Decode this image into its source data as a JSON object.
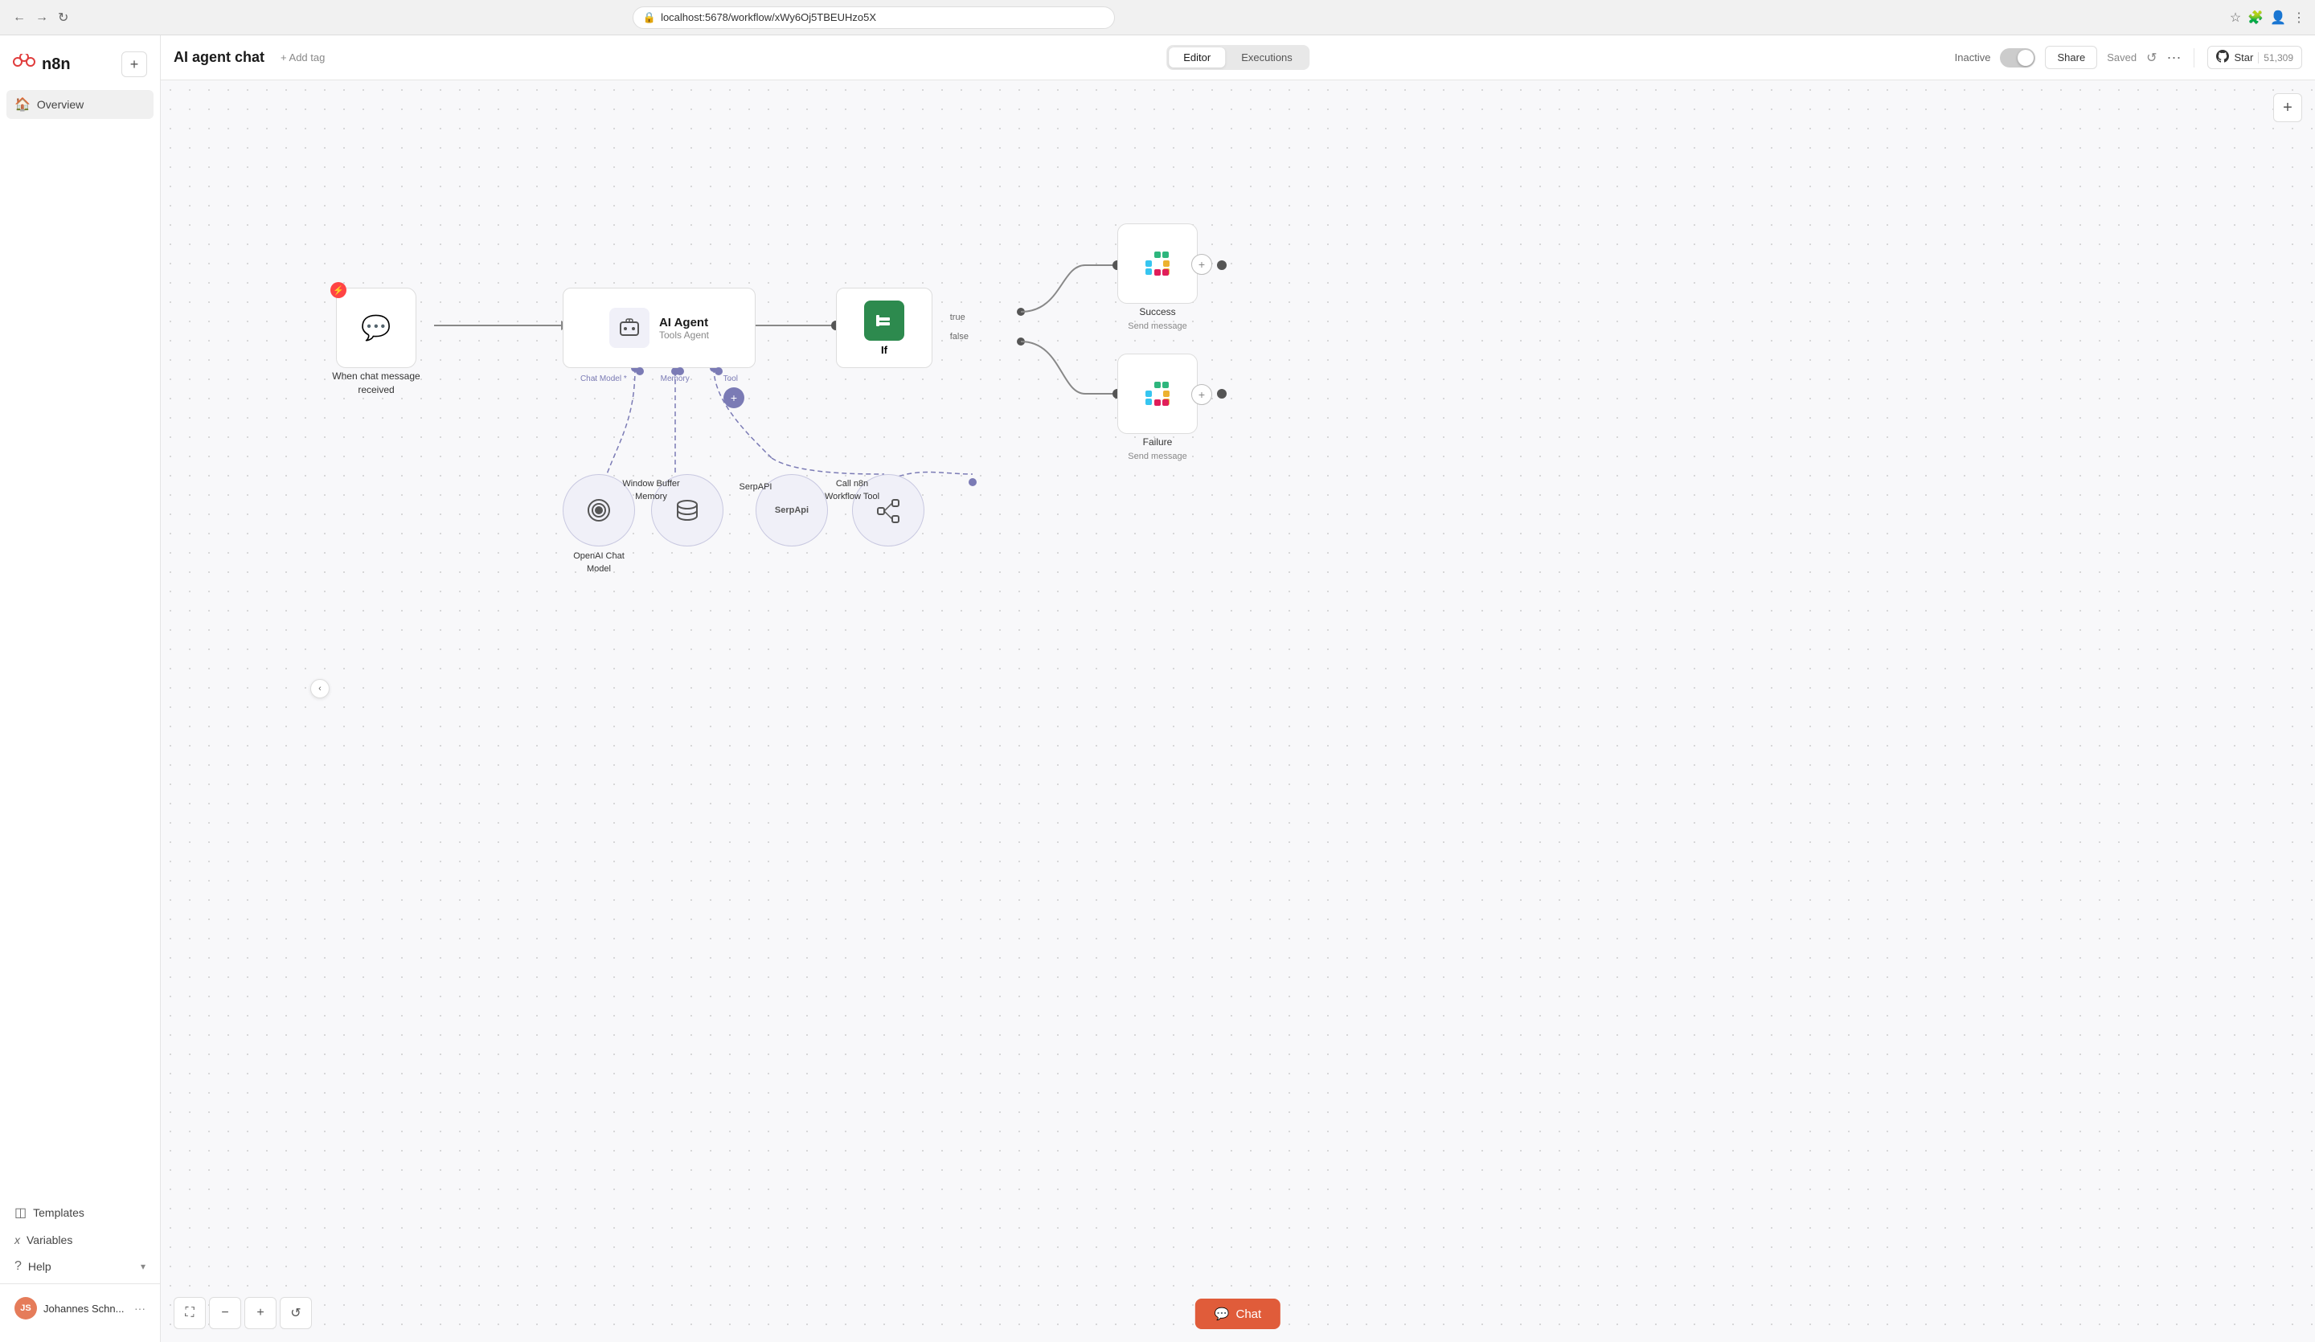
{
  "browser": {
    "url": "localhost:5678/workflow/xWy6Oj5TBEUHzo5X",
    "back": "←",
    "forward": "→",
    "refresh": "↻",
    "lock_icon": "🔒",
    "star_icon": "☆",
    "extensions_icon": "🧩",
    "profile_icon": "👤",
    "menu_icon": "⋮"
  },
  "sidebar": {
    "logo_text": "n8n",
    "add_button": "+",
    "nav_items": [
      {
        "id": "overview",
        "label": "Overview",
        "icon": "🏠"
      },
      {
        "id": "templates",
        "label": "Templates",
        "icon": "◫"
      },
      {
        "id": "variables",
        "label": "Variables",
        "icon": "✕"
      },
      {
        "id": "help",
        "label": "Help",
        "icon": "?"
      }
    ],
    "user": {
      "initials": "JS",
      "name": "Johannes Schn...",
      "more_icon": "···"
    },
    "collapse_icon": "‹"
  },
  "workflow_header": {
    "title": "AI agent chat",
    "add_tag": "+ Add tag",
    "inactive_label": "Inactive",
    "share_label": "Share",
    "saved_label": "Saved",
    "history_icon": "↺",
    "more_icon": "···",
    "star_label": "Star",
    "star_count": "51,309",
    "github_icon": "⬡"
  },
  "tabs": [
    {
      "id": "editor",
      "label": "Editor",
      "active": true
    },
    {
      "id": "executions",
      "label": "Executions",
      "active": false
    }
  ],
  "canvas": {
    "zoom_add": "+",
    "nodes": {
      "trigger": {
        "label": "When chat message",
        "label2": "received",
        "icon": "💬",
        "lightning": "⚡"
      },
      "ai_agent": {
        "label": "AI Agent",
        "sublabel": "Tools Agent",
        "connector_labels": [
          "Chat Model *",
          "Memory",
          "Tool"
        ]
      },
      "if_node": {
        "label": "If"
      },
      "success": {
        "label": "Success",
        "sublabel": "Send message"
      },
      "failure": {
        "label": "Failure",
        "sublabel": "Send message"
      },
      "openai": {
        "label": "OpenAI Chat",
        "label2": "Model"
      },
      "window_buffer": {
        "label": "Window Buffer",
        "label2": "Memory"
      },
      "serpapi": {
        "label": "SerpAPI"
      },
      "call_n8n": {
        "label": "Call n8n",
        "label2": "Workflow Tool"
      }
    }
  },
  "bottom_toolbar": {
    "fullscreen_icon": "⛶",
    "zoom_out_icon": "−",
    "zoom_in_icon": "+",
    "reset_icon": "↺"
  },
  "chat_button": {
    "icon": "💬",
    "label": "Chat"
  }
}
